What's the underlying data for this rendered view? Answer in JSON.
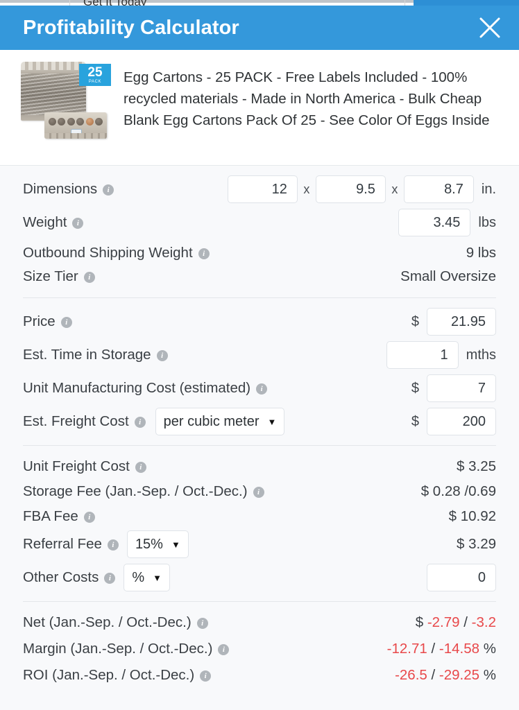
{
  "background_page": {
    "partial_text": "Get It Today"
  },
  "modal": {
    "title": "Profitability Calculator",
    "close_icon": "close-icon",
    "header_color": "#3498db"
  },
  "product": {
    "title": "Egg Cartons - 25 PACK - Free Labels Included - 100% recycled materials - Made in North America - Bulk Cheap Blank Egg Cartons Pack Of 25 - See Color Of Eggs Inside",
    "badge_number": "25",
    "badge_sub": "PACK",
    "badge_color": "#29a3dd"
  },
  "sections": {
    "dimensions": {
      "dimensions_label": "Dimensions",
      "dim_length": "12",
      "dim_width": "9.5",
      "dim_height": "8.7",
      "dim_sep": "x",
      "dim_unit": "in.",
      "weight_label": "Weight",
      "weight_value": "3.45",
      "weight_unit": "lbs",
      "outbound_label": "Outbound Shipping Weight",
      "outbound_value": "9 lbs",
      "size_tier_label": "Size Tier",
      "size_tier_value": "Small Oversize"
    },
    "costs": {
      "price_label": "Price",
      "price_currency": "$",
      "price_value": "21.95",
      "storage_time_label": "Est. Time in Storage",
      "storage_time_value": "1",
      "storage_time_unit": "mths",
      "manufacturing_label": "Unit Manufacturing Cost (estimated)",
      "manufacturing_currency": "$",
      "manufacturing_value": "7",
      "freight_label": "Est. Freight Cost",
      "freight_mode": "per cubic meter",
      "freight_currency": "$",
      "freight_value": "200"
    },
    "fees": {
      "unit_freight_label": "Unit Freight Cost",
      "unit_freight_value": "$ 3.25",
      "storage_fee_label": "Storage Fee (Jan.-Sep. / Oct.-Dec.)",
      "storage_fee_value": "$ 0.28 /0.69",
      "fba_fee_label": "FBA Fee",
      "fba_fee_value": "$ 10.92",
      "referral_fee_label": "Referral Fee",
      "referral_fee_percent": "15%",
      "referral_fee_value": "$ 3.29",
      "other_costs_label": "Other Costs",
      "other_costs_mode": "%",
      "other_costs_value": "0"
    },
    "results": {
      "net_label": "Net (Jan.-Sep. / Oct.-Dec.)",
      "net_currency": "$",
      "net_first": "-2.79",
      "net_sep": "/",
      "net_second": "-3.2",
      "margin_label": "Margin (Jan.-Sep. / Oct.-Dec.)",
      "margin_first": "-12.71",
      "margin_sep": "/",
      "margin_second": "-14.58",
      "margin_unit": "%",
      "roi_label": "ROI (Jan.-Sep. / Oct.-Dec.)",
      "roi_first": "-26.5",
      "roi_sep": "/",
      "roi_second": "-29.25",
      "roi_unit": "%",
      "negative_color": "#e8484a"
    }
  },
  "icons": {
    "info": "i"
  }
}
